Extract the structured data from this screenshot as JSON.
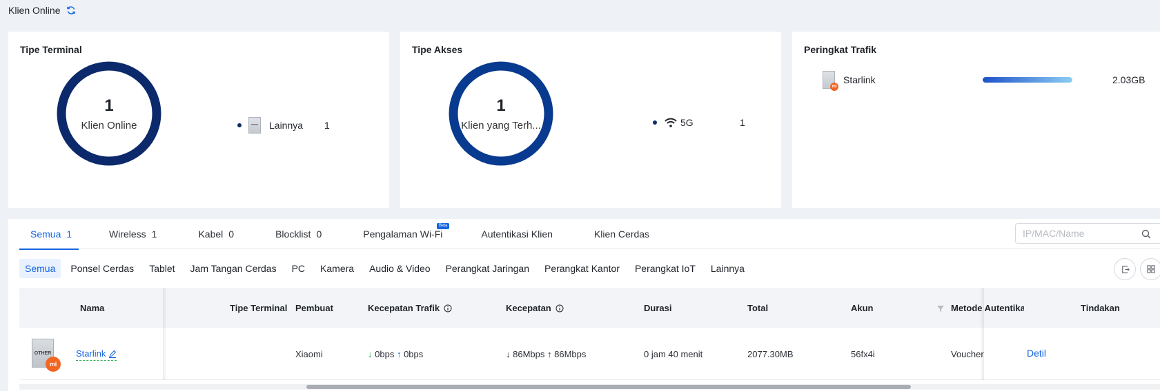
{
  "header": {
    "title": "Klien Online",
    "refresh_icon": "refresh-icon"
  },
  "cards": {
    "terminal": {
      "title": "Tipe Terminal",
      "donut_value": "1",
      "donut_label": "Klien Online",
      "legend": {
        "label": "Lainnya",
        "count": "1",
        "icon": "device-icon"
      }
    },
    "access": {
      "title": "Tipe Akses",
      "donut_value": "1",
      "donut_label": "Klien yang Terh...",
      "legend": {
        "label": "5G",
        "count": "1",
        "icon": "wifi-icon"
      }
    },
    "traffic": {
      "title": "Peringkat Trafik",
      "rows": [
        {
          "name": "Starlink",
          "value": "2.03GB",
          "share": 1.0
        }
      ]
    }
  },
  "tabs": [
    {
      "label": "Semua",
      "count": "1",
      "active": true
    },
    {
      "label": "Wireless",
      "count": "1"
    },
    {
      "label": "Kabel",
      "count": "0"
    },
    {
      "label": "Blocklist",
      "count": "0"
    },
    {
      "label": "Pengalaman Wi-Fi",
      "badge": "Beta"
    },
    {
      "label": "Autentikasi Klien"
    },
    {
      "label": "Klien Cerdas"
    }
  ],
  "search": {
    "placeholder": "IP/MAC/Name"
  },
  "filters": [
    "Semua",
    "Ponsel Cerdas",
    "Tablet",
    "Jam Tangan Cerdas",
    "PC",
    "Kamera",
    "Audio & Video",
    "Perangkat Jaringan",
    "Perangkat Kantor",
    "Perangkat IoT",
    "Lainnya"
  ],
  "table": {
    "headers": {
      "name": "Nama",
      "terminal": "Tipe Terminal",
      "maker": "Pembuat",
      "traffic_speed": "Kecepatan Trafik",
      "speed": "Kecepatan",
      "duration": "Durasi",
      "total": "Total",
      "account": "Akun",
      "auth": "Metode Autentikasi",
      "action": "Tindakan"
    },
    "row": {
      "device_tag": "OTHER",
      "brand_badge": "mi",
      "name": "Starlink",
      "maker": "Xiaomi",
      "traffic_down": "0bps",
      "traffic_up": "0bps",
      "speed_down": "86Mbps",
      "speed_up": "86Mbps",
      "duration": "0 jam 40 menit",
      "total": "2077.30MB",
      "account": "56fx4i",
      "auth": "Voucher",
      "action": "Detil"
    }
  },
  "colors": {
    "accent": "#1565e0",
    "donut": "#0c2a6b",
    "donut2": "#083a8f"
  }
}
